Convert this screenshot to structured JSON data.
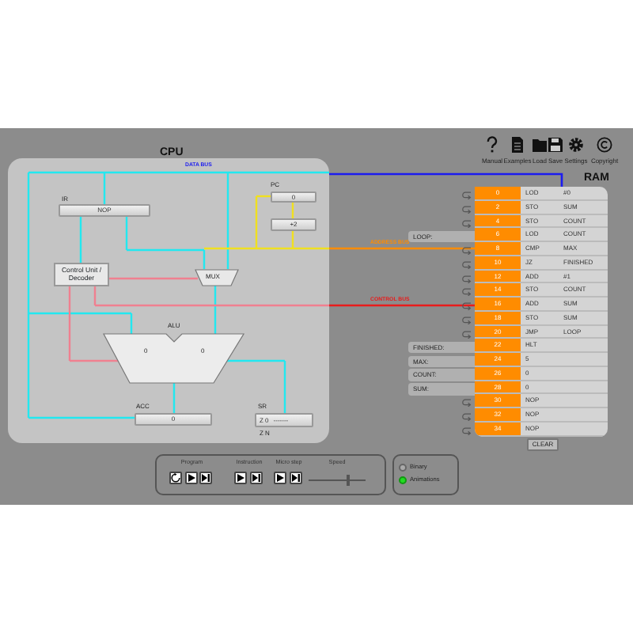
{
  "toolbar": [
    {
      "kind": "help",
      "label": "Manual"
    },
    {
      "kind": "file",
      "label": "Examples"
    },
    {
      "kind": "folder",
      "label": "Load"
    },
    {
      "kind": "save",
      "label": "Save"
    },
    {
      "kind": "gear",
      "label": "Settings"
    },
    {
      "kind": "copyright",
      "label": "Copyright"
    }
  ],
  "cpu": {
    "title": "CPU",
    "ir": {
      "label": "IR",
      "value": "NOP"
    },
    "pc": {
      "label": "PC",
      "value": "0"
    },
    "incrementer": "+2",
    "control_unit": "Control Unit / Decoder",
    "mux": "MUX",
    "alu": {
      "label": "ALU",
      "input_a": "0",
      "input_b": "0"
    },
    "acc": {
      "label": "ACC",
      "value": "0"
    },
    "sr": {
      "label": "SR",
      "flags": "Z 0",
      "bits": "-------",
      "flag_names": "Z N"
    }
  },
  "buses": [
    {
      "label": "DATA BUS",
      "color": "#1c1cf0"
    },
    {
      "label": "ADDRESS BUS",
      "color": "#ff8c00"
    },
    {
      "label": "CONTROL BUS",
      "color": "#e81c1c"
    }
  ],
  "ram": {
    "title": "RAM",
    "rows": [
      {
        "address": "0",
        "opcode": "LOD",
        "operand": "#0"
      },
      {
        "address": "2",
        "opcode": "STO",
        "operand": "SUM"
      },
      {
        "address": "4",
        "opcode": "STO",
        "operand": "COUNT"
      },
      {
        "address": "6",
        "opcode": "LOD",
        "operand": "COUNT",
        "label": "LOOP:"
      },
      {
        "address": "8",
        "opcode": "CMP",
        "operand": "MAX"
      },
      {
        "address": "10",
        "opcode": "JZ",
        "operand": "FINISHED"
      },
      {
        "address": "12",
        "opcode": "ADD",
        "operand": "#1"
      },
      {
        "address": "14",
        "opcode": "STO",
        "operand": "COUNT"
      },
      {
        "address": "16",
        "opcode": "ADD",
        "operand": "SUM"
      },
      {
        "address": "18",
        "opcode": "STO",
        "operand": "SUM"
      },
      {
        "address": "20",
        "opcode": "JMP",
        "operand": "LOOP"
      },
      {
        "address": "22",
        "opcode": "HLT",
        "operand": "",
        "label": "FINISHED:"
      },
      {
        "address": "24",
        "opcode": "5",
        "operand": "",
        "label": "MAX:"
      },
      {
        "address": "26",
        "opcode": "0",
        "operand": "",
        "label": "COUNT:"
      },
      {
        "address": "28",
        "opcode": "0",
        "operand": "",
        "label": "SUM:"
      },
      {
        "address": "30",
        "opcode": "NOP",
        "operand": ""
      },
      {
        "address": "32",
        "opcode": "NOP",
        "operand": ""
      },
      {
        "address": "34",
        "opcode": "NOP",
        "operand": ""
      }
    ],
    "clear": "CLEAR"
  },
  "controls": {
    "groups": [
      {
        "title": "Program",
        "buttons": [
          {
            "kind": "reset"
          },
          {
            "kind": "play"
          },
          {
            "kind": "step"
          }
        ]
      },
      {
        "title": "Instruction",
        "buttons": [
          {
            "kind": "play"
          },
          {
            "kind": "step"
          }
        ]
      },
      {
        "title": "Micro step",
        "buttons": [
          {
            "kind": "play"
          },
          {
            "kind": "step"
          }
        ]
      }
    ],
    "speed": {
      "label": "Speed",
      "level": 0.72
    }
  },
  "options": [
    {
      "label": "Binary",
      "selected": false
    },
    {
      "label": "Animations",
      "selected": true
    }
  ]
}
